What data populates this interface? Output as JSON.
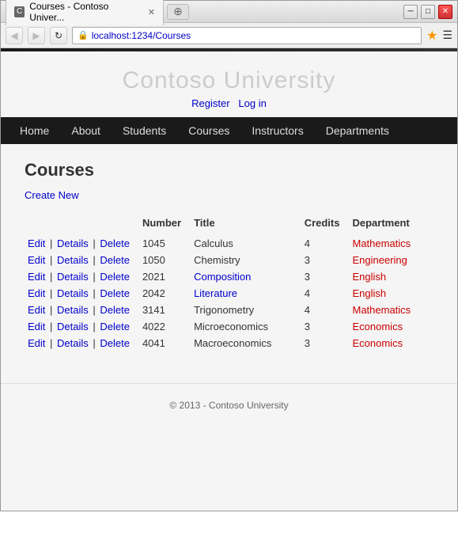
{
  "browser": {
    "tab_title": "Courses - Contoso Univer...",
    "address": "localhost:1234/Courses",
    "back_btn": "◀",
    "forward_btn": "▶",
    "refresh_btn": "↻",
    "min_btn": "─",
    "max_btn": "□",
    "close_btn": "✕"
  },
  "site": {
    "title": "Contoso University",
    "auth": {
      "register": "Register",
      "login": "Log in"
    }
  },
  "nav": {
    "items": [
      {
        "label": "Home",
        "href": "#"
      },
      {
        "label": "About",
        "href": "#"
      },
      {
        "label": "Students",
        "href": "#"
      },
      {
        "label": "Courses",
        "href": "#"
      },
      {
        "label": "Instructors",
        "href": "#"
      },
      {
        "label": "Departments",
        "href": "#"
      }
    ]
  },
  "page": {
    "title": "Courses",
    "create_new": "Create New"
  },
  "table": {
    "headers": [
      "Number",
      "Title",
      "Credits",
      "Department"
    ],
    "rows": [
      {
        "number": "1045",
        "title": "Calculus",
        "credits": "4",
        "department": "Mathematics",
        "title_is_link": false
      },
      {
        "number": "1050",
        "title": "Chemistry",
        "credits": "3",
        "department": "Engineering",
        "title_is_link": false
      },
      {
        "number": "2021",
        "title": "Composition",
        "credits": "3",
        "department": "English",
        "title_is_link": true
      },
      {
        "number": "2042",
        "title": "Literature",
        "credits": "4",
        "department": "English",
        "title_is_link": true
      },
      {
        "number": "3141",
        "title": "Trigonometry",
        "credits": "4",
        "department": "Mathematics",
        "title_is_link": false
      },
      {
        "number": "4022",
        "title": "Microeconomics",
        "credits": "3",
        "department": "Economics",
        "title_is_link": false
      },
      {
        "number": "4041",
        "title": "Macroeconomics",
        "credits": "3",
        "department": "Economics",
        "title_is_link": false
      }
    ],
    "actions": [
      "Edit",
      "Details",
      "Delete"
    ]
  },
  "footer": {
    "text": "© 2013 - Contoso University"
  }
}
